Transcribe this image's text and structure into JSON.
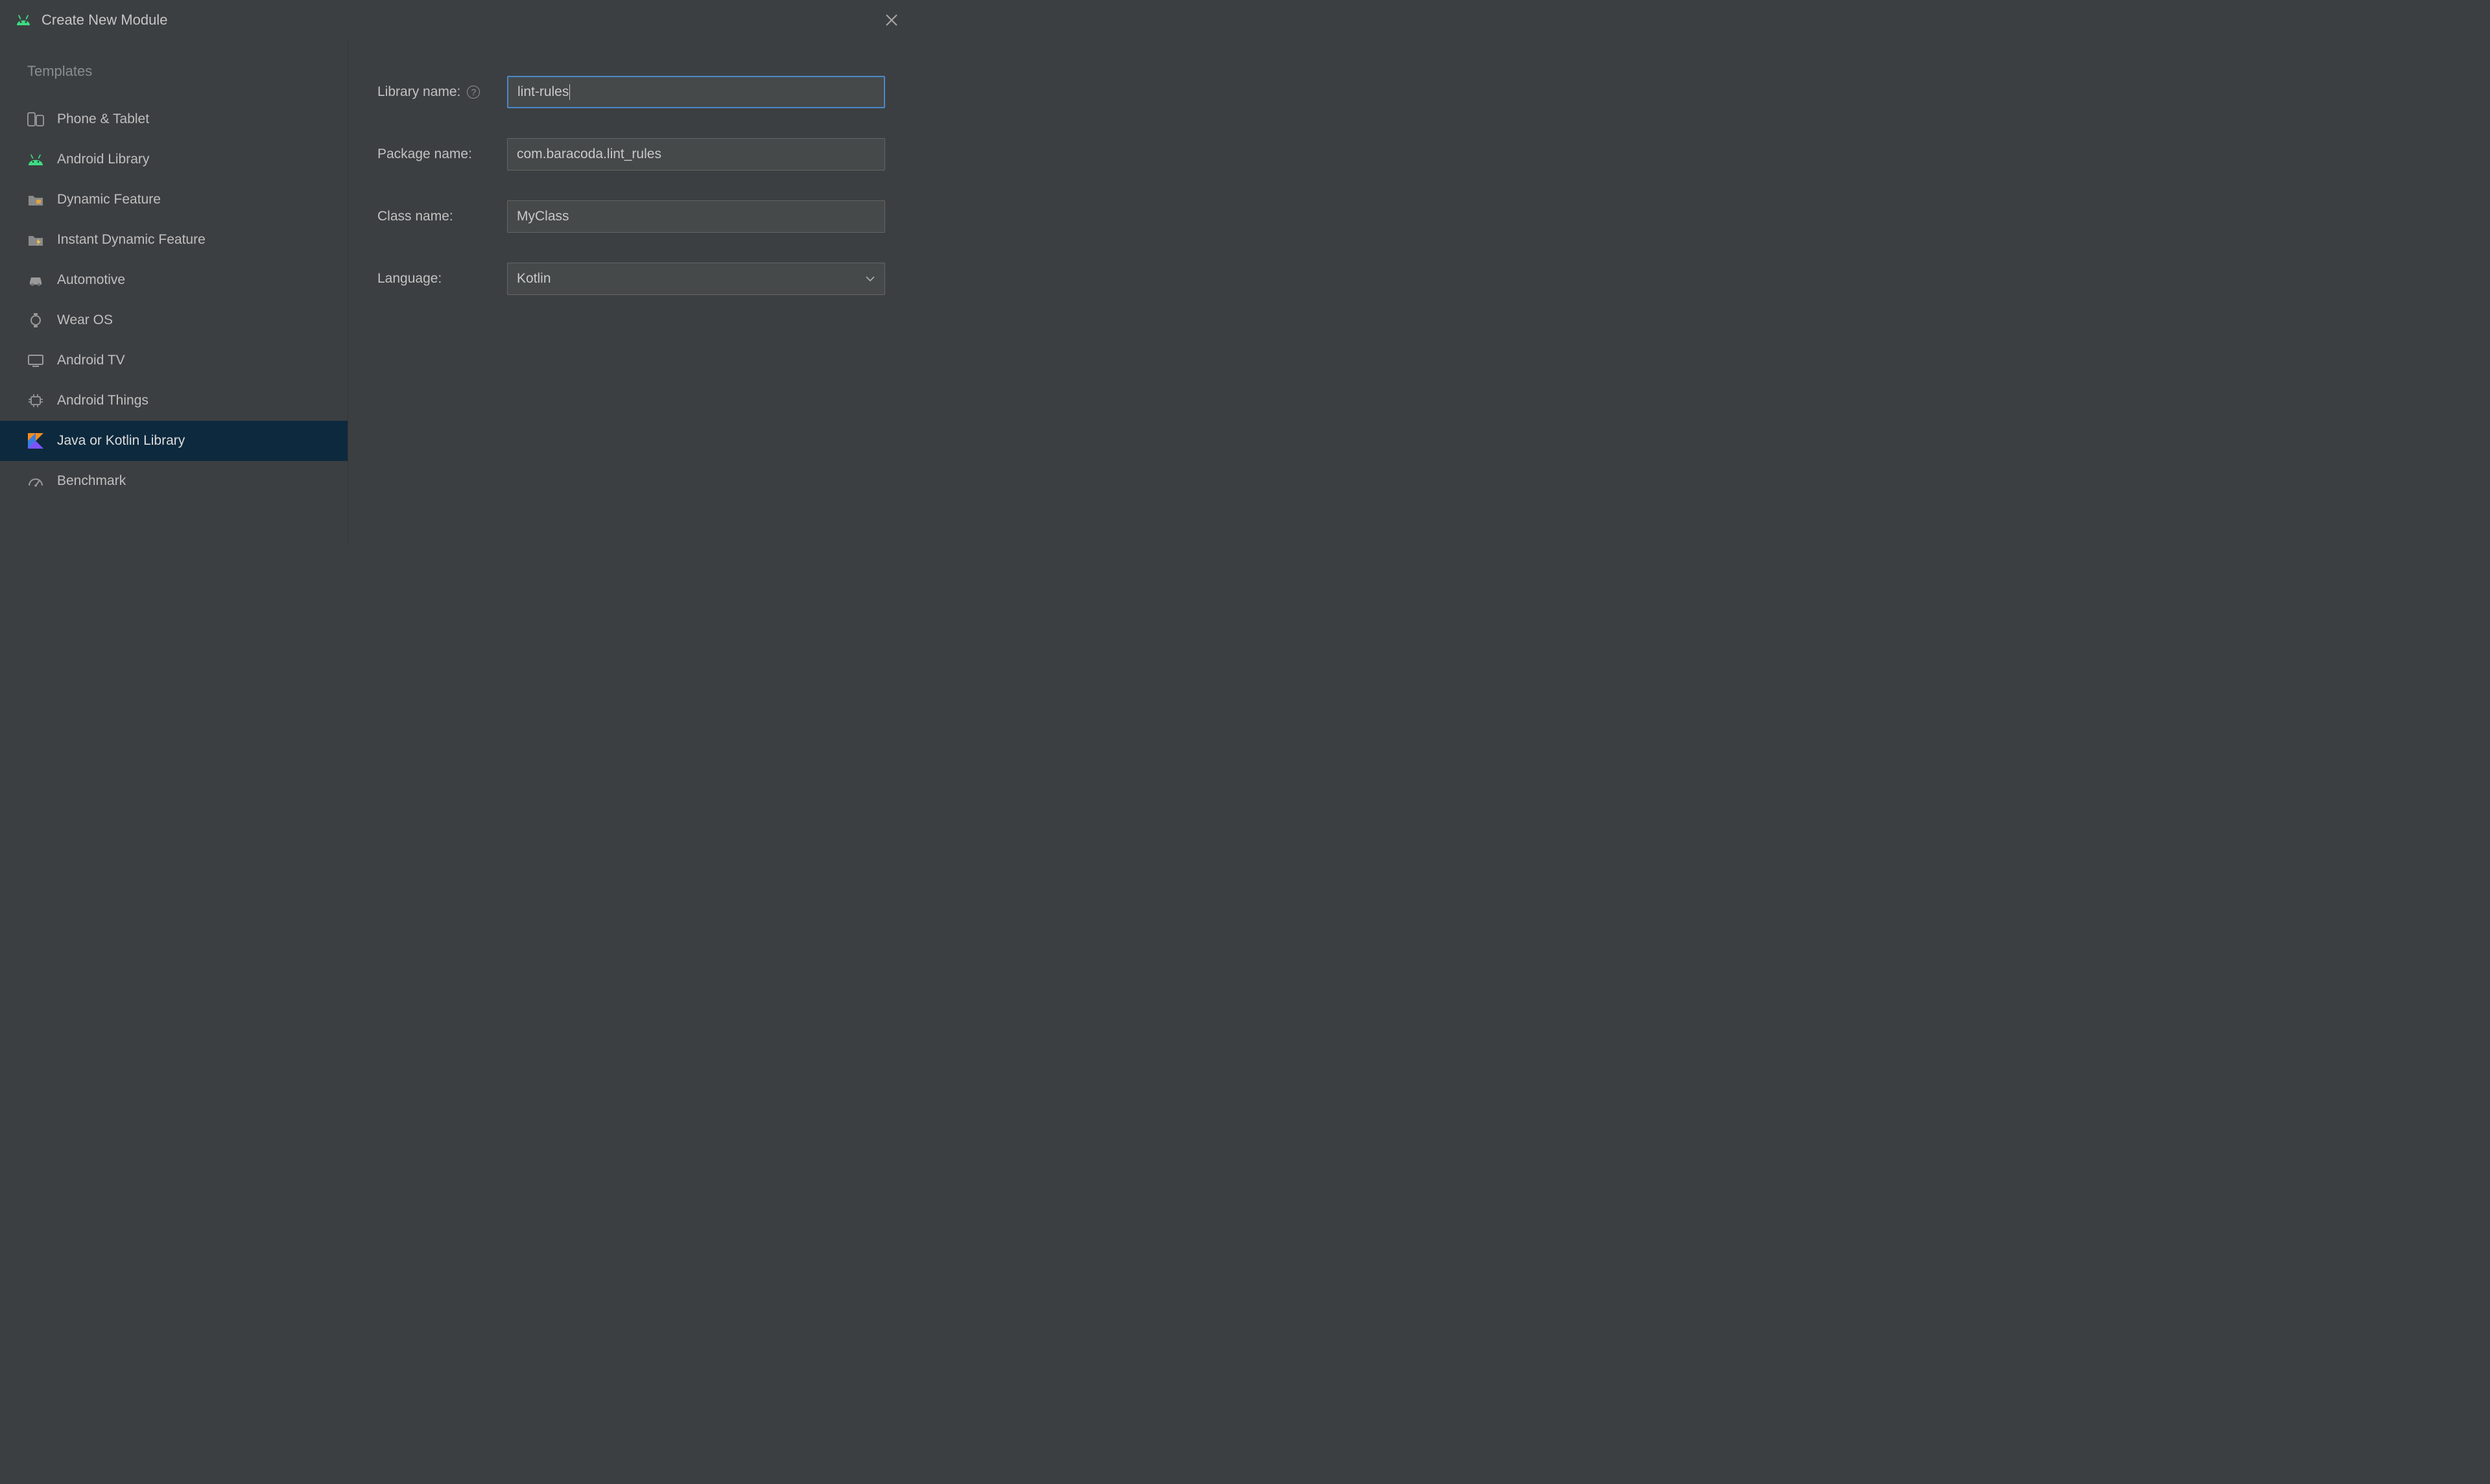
{
  "dialog": {
    "title": "Create New Module"
  },
  "sidebar": {
    "header": "Templates",
    "items": [
      {
        "icon": "phone-tablet",
        "label": "Phone & Tablet"
      },
      {
        "icon": "android",
        "label": "Android Library"
      },
      {
        "icon": "dynamic",
        "label": "Dynamic Feature"
      },
      {
        "icon": "instant",
        "label": "Instant Dynamic Feature"
      },
      {
        "icon": "car",
        "label": "Automotive"
      },
      {
        "icon": "watch",
        "label": "Wear OS"
      },
      {
        "icon": "tv",
        "label": "Android TV"
      },
      {
        "icon": "chip",
        "label": "Android Things"
      },
      {
        "icon": "kotlin",
        "label": "Java or Kotlin Library",
        "selected": true
      },
      {
        "icon": "benchmark",
        "label": "Benchmark"
      }
    ]
  },
  "form": {
    "libraryName": {
      "label": "Library name:",
      "value": "lint-rules",
      "focused": true
    },
    "packageName": {
      "label": "Package name:",
      "value": "com.baracoda.lint_rules"
    },
    "className": {
      "label": "Class name:",
      "value": "MyClass"
    },
    "language": {
      "label": "Language:",
      "value": "Kotlin"
    }
  }
}
